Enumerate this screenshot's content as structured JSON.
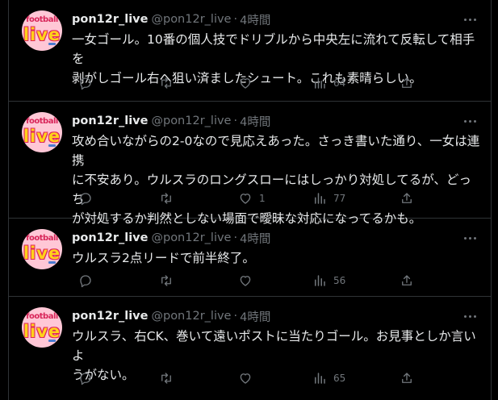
{
  "avatar": {
    "top_text": "football",
    "main_text": "live"
  },
  "tweets": [
    {
      "name": "pon12r_live",
      "handle": "@pon12r_live",
      "sep": "·",
      "time": "4時間",
      "text": "一女ゴール。10番の個人技でドリブルから中央左に流れて反転して相手を\n剥がしゴール右へ狙い済ましたシュート。これも素晴らしい。",
      "replies": "",
      "retweets": "",
      "likes": "",
      "views": "64"
    },
    {
      "name": "pon12r_live",
      "handle": "@pon12r_live",
      "sep": "·",
      "time": "4時間",
      "text": "攻め合いながらの2-0なので見応えあった。さっき書いた通り、一女は連携\nに不安あり。ウルスラのロングスローにはしっかり対処してるが、どっち\nが対処するか判然としない場面で曖昧な対応になってるかも。",
      "replies": "",
      "retweets": "",
      "likes": "1",
      "views": "77"
    },
    {
      "name": "pon12r_live",
      "handle": "@pon12r_live",
      "sep": "·",
      "time": "4時間",
      "text": "ウルスラ2点リードで前半終了。",
      "replies": "",
      "retweets": "",
      "likes": "",
      "views": "56"
    },
    {
      "name": "pon12r_live",
      "handle": "@pon12r_live",
      "sep": "·",
      "time": "4時間",
      "text": "ウルスラ、右CK、巻いて遠いポストに当たりゴール。お見事としか言いよ\nうがない。",
      "replies": "",
      "retweets": "",
      "likes": "",
      "views": "65"
    }
  ],
  "colors": {
    "background": "#000000",
    "text": "#e7e9ea",
    "secondary": "#71767b",
    "border": "#2f3336",
    "avatar_bg": "#ffc7d6"
  },
  "icons": [
    "reply-icon",
    "retweet-icon",
    "like-icon",
    "views-icon",
    "share-icon",
    "more-icon"
  ]
}
